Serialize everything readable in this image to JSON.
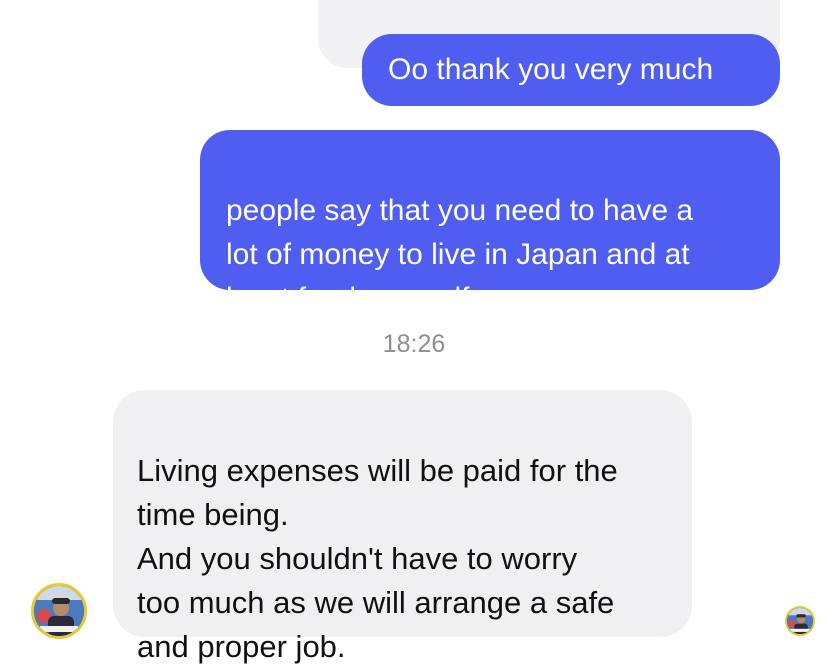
{
  "conversation": {
    "messages": [
      {
        "direction": "outgoing",
        "text": "Oo thank you very much"
      },
      {
        "direction": "outgoing",
        "text": "people say that you need to have a\nlot of money to live in Japan and at\nleast feed yourself.."
      },
      {
        "direction": "incoming",
        "text": "Living expenses will be paid for the\ntime being.\nAnd you shouldn't have to worry\ntoo much as we will arrange a safe\nand proper job."
      }
    ],
    "timestamp": "18:26"
  },
  "colors": {
    "outgoing_bubble": "#4f5df1",
    "incoming_bubble": "#f0f0f2",
    "timestamp_text": "#8e8e93",
    "avatar_ring": "#e9c934"
  },
  "icons": {
    "contact_avatar": "avatar-icon",
    "read_receipt": "read-receipt-avatar-icon"
  }
}
